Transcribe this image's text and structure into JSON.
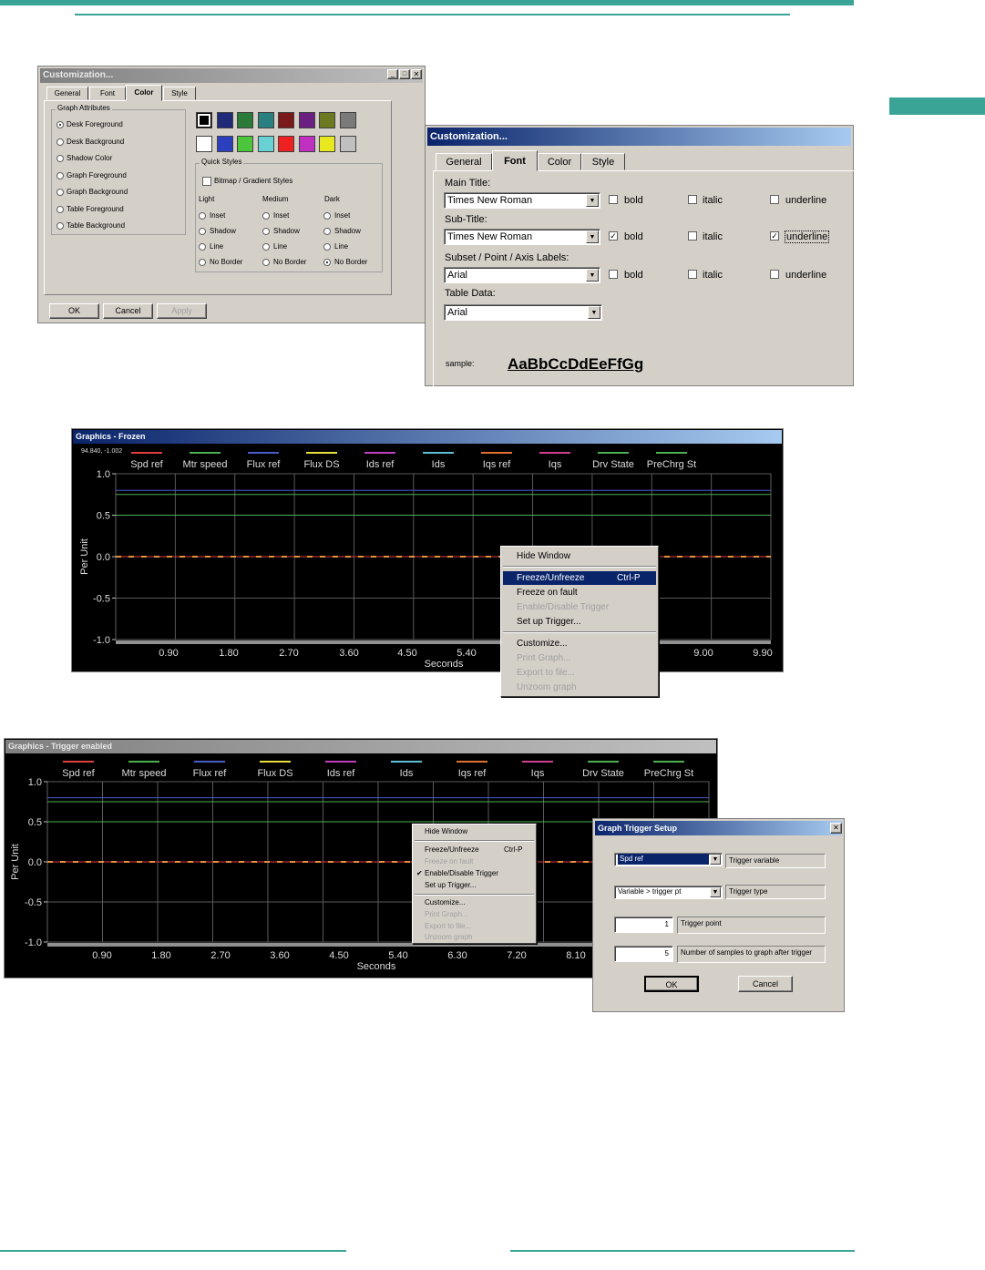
{
  "page": {
    "accent": "#3aa596"
  },
  "color_dialog": {
    "title": "Customization...",
    "tabs": [
      "General",
      "Font",
      "Color",
      "Style"
    ],
    "group_graph_attributes": "Graph Attributes",
    "attributes": [
      "Desk Foreground",
      "Desk Background",
      "Shadow Color",
      "Graph Foreground",
      "Graph Background",
      "Table Foreground",
      "Table Background"
    ],
    "selected_attribute": 0,
    "palette_row1": [
      "#000000",
      "#1f2a78",
      "#2a7a3a",
      "#2a7f80",
      "#7a1a1a",
      "#6a2080",
      "#6e7a22",
      "#7a7a7a"
    ],
    "palette_row2": [
      "#ffffff",
      "#2c3fbf",
      "#4cc43c",
      "#69d0d4",
      "#ee2020",
      "#c030c0",
      "#e8e820",
      "#c0c0c0"
    ],
    "quick_styles": "Quick Styles",
    "bitmap_label": "Bitmap / Gradient Styles",
    "columns": [
      "Light",
      "Medium",
      "Dark"
    ],
    "style_options": [
      "Inset",
      "Shadow",
      "Line",
      "No Border"
    ],
    "ok": "OK",
    "cancel": "Cancel",
    "apply": "Apply"
  },
  "font_dialog": {
    "title": "Customization...",
    "tabs": [
      "General",
      "Font",
      "Color",
      "Style"
    ],
    "main_title_label": "Main Title:",
    "main_title_font": "Times New Roman",
    "sub_title_label": "Sub-Title:",
    "sub_title_font": "Times New Roman",
    "subset_label": "Subset / Point / Axis Labels:",
    "subset_font": "Arial",
    "table_label": "Table Data:",
    "table_font": "Arial",
    "bold": "bold",
    "italic": "italic",
    "underline": "underline",
    "sample_label": "sample:",
    "sample_text": "AaBbCcDdEeFfGg"
  },
  "graph1": {
    "title": "Graphics - Frozen",
    "coords": "94.840, -1.002",
    "ylabel": "Per Unit",
    "xlabel": "Seconds",
    "yticks": [
      "1.0",
      "0.5",
      "0.0",
      "-0.5",
      "-1.0"
    ],
    "xticks": [
      "0.90",
      "1.80",
      "2.70",
      "3.60",
      "4.50",
      "5.40",
      "9.00",
      "9.90"
    ],
    "legend": [
      {
        "name": "Spd ref",
        "color": "#e04040"
      },
      {
        "name": "Mtr speed",
        "color": "#4caf50"
      },
      {
        "name": "Flux ref",
        "color": "#4a5cc8"
      },
      {
        "name": "Flux DS",
        "color": "#e8e040"
      },
      {
        "name": "Ids ref",
        "color": "#c040c0"
      },
      {
        "name": "Ids",
        "color": "#60c0d8"
      },
      {
        "name": "Iqs ref",
        "color": "#e07030"
      },
      {
        "name": "Iqs",
        "color": "#d04090"
      },
      {
        "name": "Drv State",
        "color": "#4caf50"
      },
      {
        "name": "PreChrg St",
        "color": "#4caf50"
      }
    ],
    "menu": {
      "hide": "Hide Window",
      "freeze": "Freeze/Unfreeze",
      "freeze_shortcut": "Ctrl-P",
      "freeze_fault": "Freeze on fault",
      "enable_trigger": "Enable/Disable Trigger",
      "setup_trigger": "Set up Trigger...",
      "customize": "Customize...",
      "print": "Print Graph...",
      "export": "Export to file...",
      "unzoom": "Unzoom graph"
    }
  },
  "graph2": {
    "title": "Graphics - Trigger enabled",
    "ylabel": "Per Unit",
    "xlabel": "Seconds",
    "yticks": [
      "1.0",
      "0.5",
      "0.0",
      "-0.5",
      "-1.0"
    ],
    "xticks": [
      "0.90",
      "1.80",
      "2.70",
      "3.60",
      "4.50",
      "5.40",
      "6.30",
      "7.20",
      "8.10"
    ],
    "legend": [
      {
        "name": "Spd ref",
        "color": "#e04040"
      },
      {
        "name": "Mtr speed",
        "color": "#4caf50"
      },
      {
        "name": "Flux ref",
        "color": "#4a5cc8"
      },
      {
        "name": "Flux DS",
        "color": "#e8e040"
      },
      {
        "name": "Ids ref",
        "color": "#c040c0"
      },
      {
        "name": "Ids",
        "color": "#60c0d8"
      },
      {
        "name": "Iqs ref",
        "color": "#e07030"
      },
      {
        "name": "Iqs",
        "color": "#d04090"
      },
      {
        "name": "Drv State",
        "color": "#4caf50"
      },
      {
        "name": "PreChrg St",
        "color": "#4caf50"
      }
    ],
    "menu": {
      "hide": "Hide Window",
      "freeze": "Freeze/Unfreeze",
      "freeze_shortcut": "Ctrl-P",
      "freeze_fault": "Freeze on fault",
      "enable_trigger": "Enable/Disable Trigger",
      "setup_trigger": "Set up Trigger...",
      "customize": "Customize...",
      "print": "Print Graph...",
      "export": "Export to file...",
      "unzoom": "Unzoom graph"
    }
  },
  "trigger_dialog": {
    "title": "Graph Trigger Setup",
    "variable_value": "Spd ref",
    "variable_label": "Trigger variable",
    "type_value": "Variable > trigger pt",
    "type_label": "Trigger type",
    "point_value": "1",
    "point_label": "Trigger point",
    "samples_value": "5",
    "samples_label": "Number of samples to graph after trigger",
    "ok": "OK",
    "cancel": "Cancel"
  }
}
